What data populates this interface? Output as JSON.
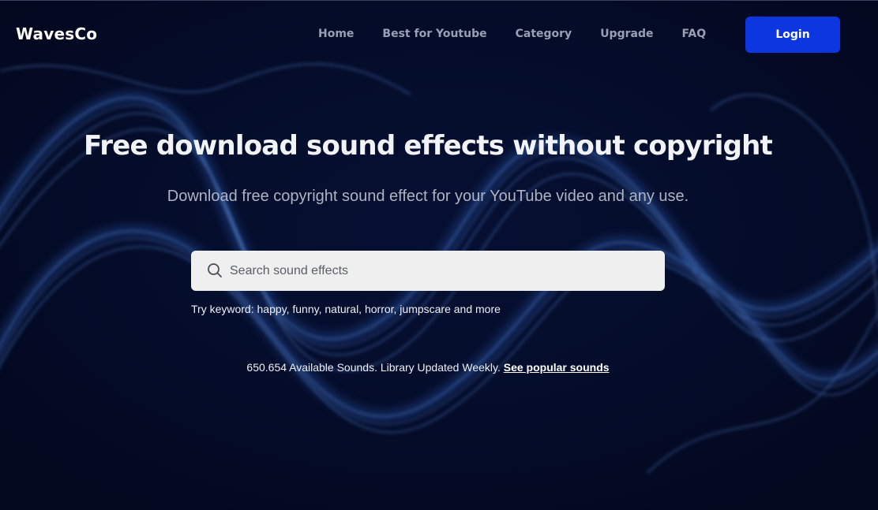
{
  "brand": {
    "logo_text": "WavesCo"
  },
  "nav": {
    "items": [
      {
        "label": "Home"
      },
      {
        "label": "Best for Youtube"
      },
      {
        "label": "Category"
      },
      {
        "label": "Upgrade"
      },
      {
        "label": "FAQ"
      }
    ],
    "login_label": "Login"
  },
  "hero": {
    "title": "Free download sound effects without copyright",
    "subtitle": "Download free copyright sound effect for your YouTube video and any use."
  },
  "search": {
    "placeholder": "Search sound effects",
    "value": "",
    "icon": "search-icon"
  },
  "keywords": {
    "text": "Try keyword: happy, funny, natural, horror, jumpscare and more"
  },
  "stats": {
    "text": "650.654 Available Sounds. Library Updated Weekly.",
    "link_label": "See popular sounds"
  },
  "colors": {
    "background": "#040a25",
    "accent": "#0b36e0",
    "search_bg": "#efefef",
    "nav_text": "#9aa0b3"
  }
}
